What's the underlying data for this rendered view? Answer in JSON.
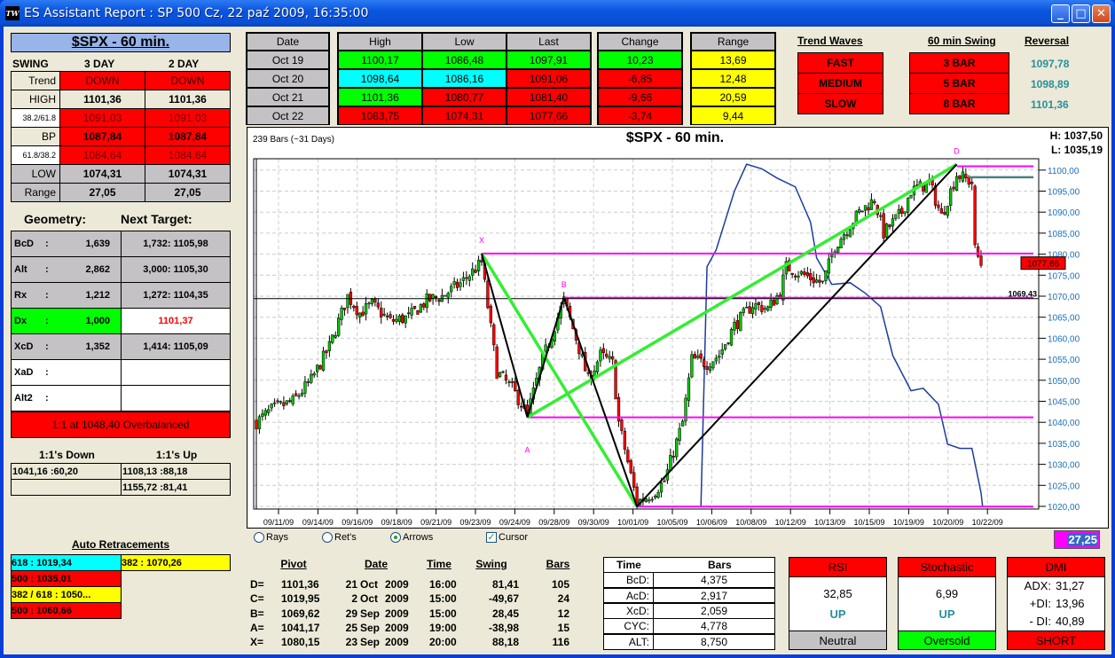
{
  "window": {
    "title": "ES Assistant Report : SP 500  Cz, 22 paź 2009, 16:35:00",
    "icon_text": "TW",
    "minimize": "_",
    "maximize": "□",
    "close": "✕"
  },
  "left": {
    "title": "$SPX - 60 min.",
    "swing_header": [
      "SWING",
      "3 DAY",
      "2 DAY"
    ],
    "swing_rows": [
      {
        "label": "Trend",
        "v1": "DOWN",
        "v2": "DOWN",
        "lbg": "#ece9d8",
        "bg": "#ff0000",
        "fg": "#300000",
        "bold": false,
        "small": false
      },
      {
        "label": "HIGH",
        "v1": "1101,36",
        "v2": "1101,36",
        "lbg": "#ece9d8",
        "bg": "#ece9d8",
        "fg": "#000000",
        "bold": true,
        "small": false
      },
      {
        "label": "38.2/61.8",
        "v1": "1091,03",
        "v2": "1091,03",
        "lbg": "#ffffff",
        "bg": "#ff0000",
        "fg": "#700000",
        "bold": false,
        "small": true
      },
      {
        "label": "BP",
        "v1": "1087,84",
        "v2": "1087,84",
        "lbg": "#ece9d8",
        "bg": "#ff0000",
        "fg": "#000000",
        "bold": true,
        "small": false
      },
      {
        "label": "61.8/38.2",
        "v1": "1084,64",
        "v2": "1084,64",
        "lbg": "#ffffff",
        "bg": "#ff0000",
        "fg": "#700000",
        "bold": false,
        "small": true
      },
      {
        "label": "LOW",
        "v1": "1074,31",
        "v2": "1074,31",
        "lbg": "#c4c2c4",
        "bg": "#c4c2c4",
        "fg": "#000000",
        "bold": true,
        "small": false
      },
      {
        "label": "Range",
        "v1": "27,05",
        "v2": "27,05",
        "lbg": "#c4c2c4",
        "bg": "#c4c2c4",
        "fg": "#000000",
        "bold": true,
        "small": false
      }
    ],
    "geometry_label": "Geometry:",
    "next_target_label": "Next Target:",
    "geometry_rows": [
      {
        "label": "BcD",
        "colon": ":",
        "value": "1,639",
        "target": "1,732: 1105,98",
        "lbg": "#c4c2c4",
        "rbg": "#c4c2c4",
        "rfg": "#000000"
      },
      {
        "label": "Alt",
        "colon": ":",
        "value": "2,862",
        "target": "3,000: 1105,30",
        "lbg": "#c4c2c4",
        "rbg": "#c4c2c4",
        "rfg": "#000000"
      },
      {
        "label": "Rx",
        "colon": ":",
        "value": "1,212",
        "target": "1,272: 1104,35",
        "lbg": "#c4c2c4",
        "rbg": "#c4c2c4",
        "rfg": "#000000"
      },
      {
        "label": "Dx",
        "colon": ":",
        "value": "1,000",
        "target": "1101,37",
        "lbg": "#00ff00",
        "rbg": "#ffffff",
        "rfg": "#ff0000"
      },
      {
        "label": "XcD",
        "colon": ":",
        "value": "1,352",
        "target": "1,414: 1105,09",
        "lbg": "#c4c2c4",
        "rbg": "#c4c2c4",
        "rfg": "#000000"
      },
      {
        "label": "XaD",
        "colon": ":",
        "value": "",
        "target": "",
        "lbg": "#ffffff",
        "rbg": "#ffffff",
        "rfg": "#000000"
      },
      {
        "label": "Alt2",
        "colon": ":",
        "value": "",
        "target": "",
        "lbg": "#ffffff",
        "rbg": "#ffffff",
        "rfg": "#000000"
      }
    ],
    "overbalanced": "1:1 at 1048,40 Overbalanced",
    "ones_down_label": "1:1's Down",
    "ones_up_label": "1:1's Up",
    "ones_rows": [
      {
        "down": "1041,16 :60,20",
        "up": "1108,13 :88,18"
      },
      {
        "down": "",
        "up": "1155,72 :81,41"
      }
    ],
    "auto_retracements_label": "Auto Retracements",
    "retracements_left": [
      {
        "text": "618 : 1019,34",
        "bg": "#00ffff"
      },
      {
        "text": "500 : 1035,01",
        "bg": "#ff0000"
      },
      {
        "text": "382 / 618 : 1050...",
        "bg": "#ffff00"
      },
      {
        "text": "500 : 1060,66",
        "bg": "#ff0000"
      }
    ],
    "retracements_right": [
      {
        "text": "382 : 1070,26",
        "bg": "#ffff00"
      }
    ]
  },
  "daily": {
    "headers": {
      "date": "Date",
      "high": "High",
      "low": "Low",
      "last": "Last",
      "change": "Change",
      "range": "Range"
    },
    "rows": [
      {
        "date": "Oct  19",
        "high": "1100,17",
        "low": "1086,48",
        "last": "1097,91",
        "change": "10,23",
        "range": "13,69",
        "hbg": "#00ff00",
        "lbg": "#00ff00",
        "lastbg": "#00ff00",
        "cbg": "#00ff00"
      },
      {
        "date": "Oct  20",
        "high": "1098,64",
        "low": "1086,16",
        "last": "1091,06",
        "change": "-6,85",
        "range": "12,48",
        "hbg": "#00ffff",
        "lbg": "#00ffff",
        "lastbg": "#ff0000",
        "cbg": "#ff0000"
      },
      {
        "date": "Oct  21",
        "high": "1101,36",
        "low": "1080,77",
        "last": "1081,40",
        "change": "-9,66",
        "range": "20,59",
        "hbg": "#00ff00",
        "lbg": "#ff0000",
        "lastbg": "#ff0000",
        "cbg": "#ff0000"
      },
      {
        "date": "Oct  22",
        "high": "1083,75",
        "low": "1074,31",
        "last": "1077,66",
        "change": "-3,74",
        "range": "9,44",
        "hbg": "#ff0000",
        "lbg": "#ff0000",
        "lastbg": "#ff0000",
        "cbg": "#ff0000"
      }
    ]
  },
  "trend": {
    "trend_waves_label": "Trend Waves",
    "swing_label": "60 min Swing",
    "reversal_label": "Reversal",
    "waves": [
      "FAST",
      "MEDIUM",
      "SLOW"
    ],
    "swings": [
      "3 BAR",
      "5 BAR",
      "8 BAR"
    ],
    "reversals": [
      "1097,78",
      "1098,89",
      "1101,36"
    ]
  },
  "chart_header": {
    "bars_info": "239 Bars (~31 Days)",
    "title": "$SPX - 60 min.",
    "high": "H:  1037,50",
    "low": "L:  1035,19",
    "cursor_value": "27,25"
  },
  "controls": {
    "rays": "Rays",
    "rets": "Ret's",
    "arrows": "Arrows",
    "cursor": "Cursor",
    "selected": "Arrows",
    "cursor_checked": true
  },
  "chart_data": {
    "type": "candlestick",
    "bars": 239,
    "ylim": [
      1018.5,
      1103.5
    ],
    "y_ticks": [
      "1100,00",
      "1095,00",
      "1090,00",
      "1085,00",
      "1080,00",
      "1075,00",
      "1070,00",
      "1065,00",
      "1060,00",
      "1055,00",
      "1050,00",
      "1045,00",
      "1040,00",
      "1035,00",
      "1030,00",
      "1025,00",
      "1020,00"
    ],
    "y_tick_values": [
      1100,
      1095,
      1090,
      1085,
      1080,
      1075,
      1070,
      1065,
      1060,
      1055,
      1050,
      1045,
      1040,
      1035,
      1030,
      1025,
      1020
    ],
    "x_ticks": [
      "09/11/09",
      "09/14/09",
      "09/16/09",
      "09/18/09",
      "09/21/09",
      "09/23/09",
      "09/24/09",
      "09/28/09",
      "09/30/09",
      "10/01/09",
      "10/05/09",
      "10/06/09",
      "10/08/09",
      "10/12/09",
      "10/13/09",
      "10/15/09",
      "10/19/09",
      "10/20/09",
      "10/22/09"
    ],
    "close_path": [
      [
        0,
        1040
      ],
      [
        5,
        1043
      ],
      [
        12,
        1045
      ],
      [
        18,
        1050
      ],
      [
        24,
        1058
      ],
      [
        30,
        1070
      ],
      [
        34,
        1066
      ],
      [
        38,
        1068
      ],
      [
        44,
        1064
      ],
      [
        50,
        1065
      ],
      [
        56,
        1069
      ],
      [
        61,
        1070
      ],
      [
        67,
        1073
      ],
      [
        74,
        1078
      ],
      [
        79,
        1052
      ],
      [
        84,
        1048
      ],
      [
        89,
        1042
      ],
      [
        94,
        1055
      ],
      [
        101,
        1069
      ],
      [
        105,
        1060
      ],
      [
        109,
        1050
      ],
      [
        113,
        1056
      ],
      [
        117,
        1054
      ],
      [
        119,
        1040
      ],
      [
        125,
        1021
      ],
      [
        130,
        1023
      ],
      [
        134,
        1026
      ],
      [
        140,
        1040
      ],
      [
        143,
        1055
      ],
      [
        148,
        1054
      ],
      [
        152,
        1056
      ],
      [
        157,
        1063
      ],
      [
        163,
        1068
      ],
      [
        168,
        1067
      ],
      [
        172,
        1071
      ],
      [
        174,
        1077
      ],
      [
        180,
        1075
      ],
      [
        186,
        1073
      ],
      [
        190,
        1082
      ],
      [
        198,
        1090
      ],
      [
        203,
        1093
      ],
      [
        206,
        1085
      ],
      [
        212,
        1090
      ],
      [
        215,
        1095
      ],
      [
        221,
        1097
      ],
      [
        225,
        1089
      ],
      [
        230,
        1099
      ],
      [
        235,
        1097
      ],
      [
        236,
        1081
      ],
      [
        238,
        1077.66
      ]
    ],
    "last_price": "1077,66",
    "pattern_points": [
      {
        "name": "X",
        "bar": 74,
        "price": 1080.15
      },
      {
        "name": "A",
        "bar": 89,
        "price": 1041.17
      },
      {
        "name": "B",
        "bar": 101,
        "price": 1069.62
      },
      {
        "name": "C",
        "bar": 125,
        "price": 1019.95
      },
      {
        "name": "D",
        "bar": 230,
        "price": 1101.36
      }
    ],
    "black_legs": [
      [
        "X",
        "A"
      ],
      [
        "A",
        "B"
      ],
      [
        "B",
        "C"
      ],
      [
        "C",
        "D"
      ]
    ],
    "green_legs": [
      [
        "X",
        "C"
      ],
      [
        "A",
        "D"
      ]
    ],
    "magenta_levels": [
      {
        "price": 1100.9,
        "from_bar": 230
      },
      {
        "price": 1080.15,
        "from_bar": 74
      },
      {
        "price": 1069.62,
        "from_bar": 101
      },
      {
        "price": 1041.17,
        "from_bar": 89
      },
      {
        "price": 1019.95,
        "from_bar": 125
      }
    ],
    "teal_level": {
      "price": 1098.3,
      "from_bar": 234
    },
    "cursor_level": {
      "price": 1069.43,
      "label": "1069,43"
    },
    "indicator_line": [
      [
        146,
        1020
      ],
      [
        148,
        1077
      ],
      [
        151,
        1081
      ],
      [
        154,
        1088
      ],
      [
        157,
        1095
      ],
      [
        161,
        1101.4
      ],
      [
        166,
        1100.3
      ],
      [
        171,
        1098.1
      ],
      [
        177,
        1096
      ],
      [
        182,
        1087.6
      ],
      [
        184,
        1079.1
      ],
      [
        189,
        1072.8
      ],
      [
        195,
        1073.2
      ],
      [
        200,
        1070.7
      ],
      [
        205,
        1067.5
      ],
      [
        209,
        1055.9
      ],
      [
        215,
        1047.5
      ],
      [
        219,
        1048.1
      ],
      [
        224,
        1044.3
      ],
      [
        227,
        1034.8
      ],
      [
        231,
        1033.8
      ],
      [
        235,
        1033.8
      ],
      [
        238,
        1023.2
      ],
      [
        238.5,
        1020
      ]
    ],
    "colors": {
      "up": "#00c800",
      "down": "#ff0000",
      "legs_green": "#33ee33",
      "magenta": "#ff00ff",
      "indicator": "#1c3c9c"
    }
  },
  "pivots": {
    "headers": {
      "pivot": "Pivot",
      "date": "Date",
      "time": "Time",
      "swing": "Swing",
      "bars": "Bars"
    },
    "rows": [
      {
        "name": "D=",
        "value": "1101,36",
        "day": "21",
        "month": "Oct",
        "year": "2009",
        "time": "16:00",
        "swing": "81,41",
        "bars": "105"
      },
      {
        "name": "C=",
        "value": "1019,95",
        "day": "2",
        "month": "Oct",
        "year": "2009",
        "time": "15:00",
        "swing": "-49,67",
        "bars": "24"
      },
      {
        "name": "B=",
        "value": "1069,62",
        "day": "29",
        "month": "Sep",
        "year": "2009",
        "time": "15:00",
        "swing": "28,45",
        "bars": "12"
      },
      {
        "name": "A=",
        "value": "1041,17",
        "day": "25",
        "month": "Sep",
        "year": "2009",
        "time": "19:00",
        "swing": "-38,98",
        "bars": "15"
      },
      {
        "name": "X=",
        "value": "1080,15",
        "day": "23",
        "month": "Sep",
        "year": "2009",
        "time": "20:00",
        "swing": "88,18",
        "bars": "116"
      }
    ]
  },
  "time_bars": {
    "headers": [
      "Time",
      "Bars"
    ],
    "rows": [
      {
        "label": "BcD:",
        "value": "4,375"
      },
      {
        "label": "AcD:",
        "value": "2,917"
      },
      {
        "label": "XcD:",
        "value": "2,059"
      },
      {
        "label": "CYC:",
        "value": "4,778"
      },
      {
        "label": "ALT:",
        "value": "8,750"
      }
    ]
  },
  "indicators": {
    "rsi": {
      "title": "RSI",
      "value": "32,85",
      "direction": "UP",
      "status": "Neutral",
      "status_bg": "#c4c2c4"
    },
    "stochastic": {
      "title": "Stochastic",
      "value": "6,99",
      "direction": "UP",
      "status": "Oversold",
      "status_bg": "#00ff00"
    },
    "dmi": {
      "title": "DMI",
      "adx_label": "ADX:",
      "adx": "31,27",
      "pdi_label": "+DI:",
      "pdi": "13,96",
      "mdi_label": "- DI:",
      "mdi": "40,89",
      "status": "SHORT",
      "status_bg": "#ff0000"
    }
  }
}
